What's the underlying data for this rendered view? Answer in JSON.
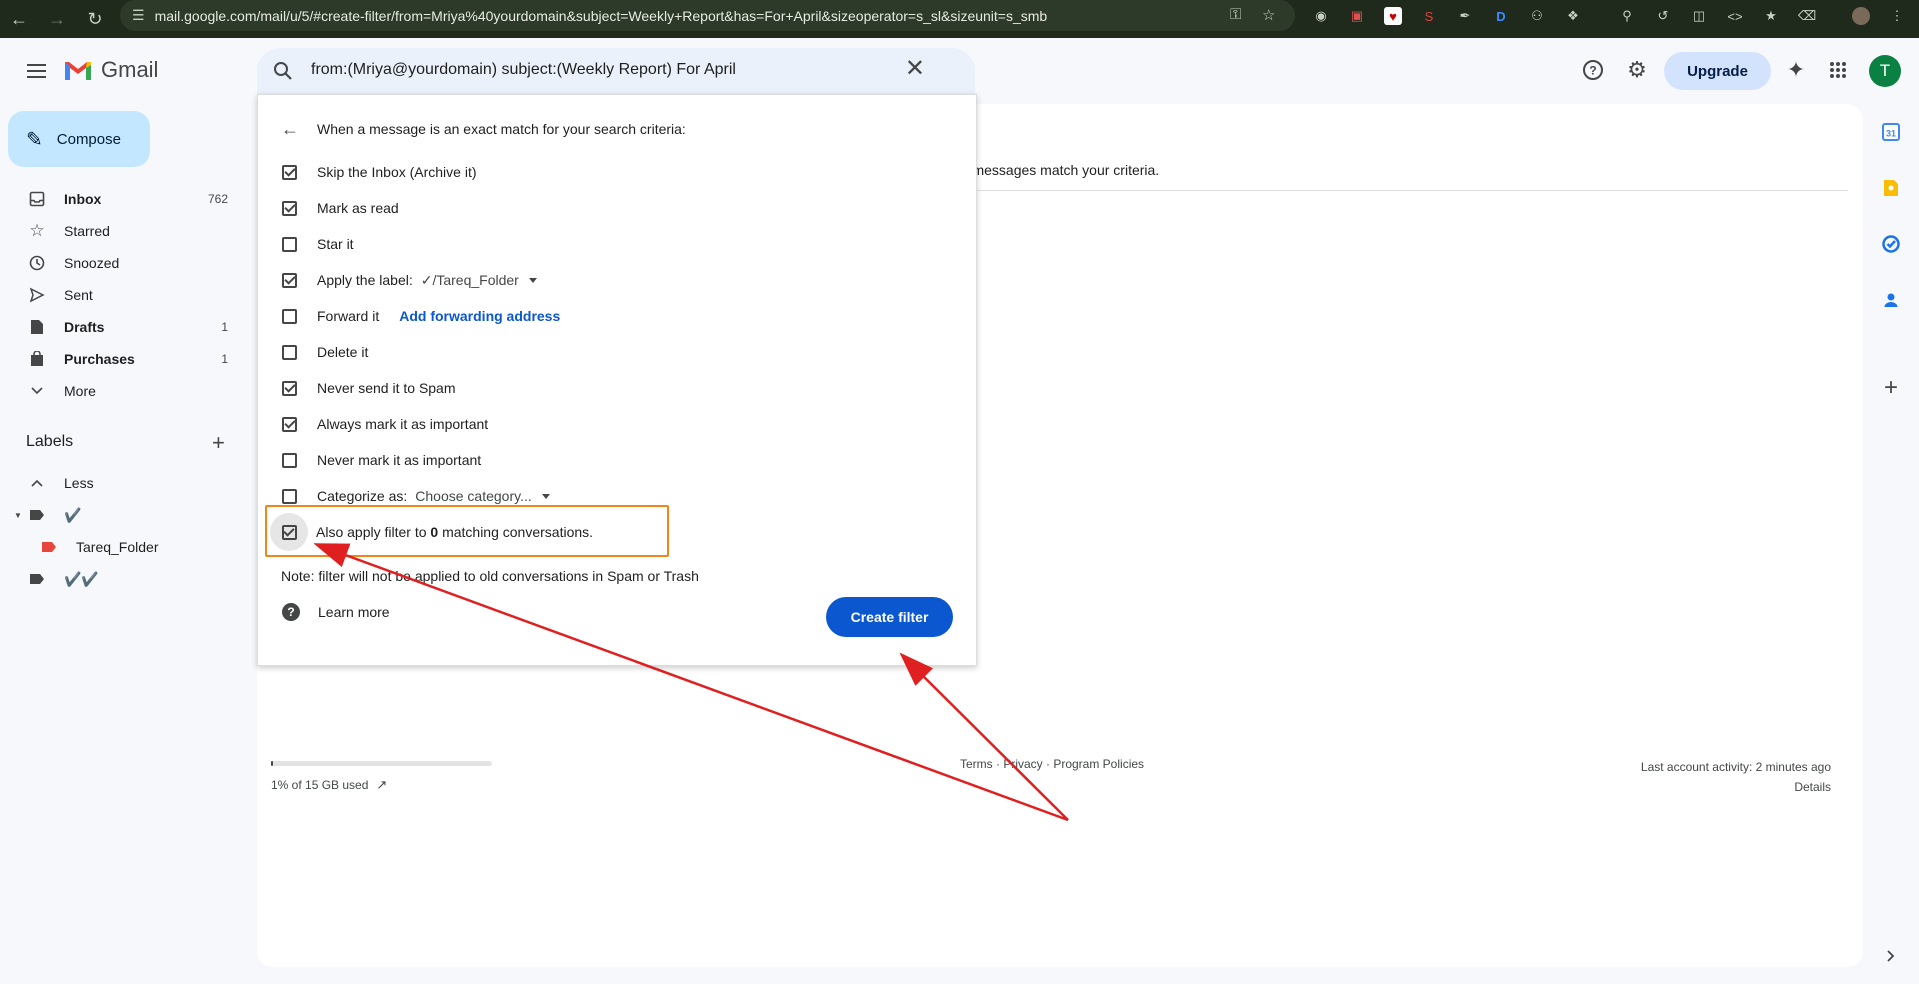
{
  "browser": {
    "url": "mail.google.com/mail/u/5/#create-filter/from=Mriya%40yourdomain&subject=Weekly+Report&has=For+April&sizeoperator=s_sl&sizeunit=s_smb"
  },
  "app": {
    "logo_text": "Gmail",
    "search_query": "from:(Mriya@yourdomain) subject:(Weekly Report) For April",
    "upgrade_label": "Upgrade",
    "avatar_letter": "T"
  },
  "sidebar": {
    "compose_label": "Compose",
    "items": [
      {
        "label": "Inbox",
        "count": "762",
        "icon": "inbox-icon"
      },
      {
        "label": "Starred",
        "count": "",
        "icon": "star-icon"
      },
      {
        "label": "Snoozed",
        "count": "",
        "icon": "clock-icon"
      },
      {
        "label": "Sent",
        "count": "",
        "icon": "send-icon"
      },
      {
        "label": "Drafts",
        "count": "1",
        "icon": "draft-icon"
      },
      {
        "label": "Purchases",
        "count": "1",
        "icon": "shopping-bag-icon"
      },
      {
        "label": "More",
        "count": "",
        "icon": "chevron-down-icon"
      }
    ],
    "labels_title": "Labels",
    "less_label": "Less",
    "labels": [
      {
        "label": "✔️"
      },
      {
        "label": "Tareq_Folder"
      },
      {
        "label": "✔️✔️"
      }
    ]
  },
  "filter_dialog": {
    "header": "When a message is an exact match for your search criteria:",
    "options": [
      {
        "label": "Skip the Inbox (Archive it)",
        "checked": true
      },
      {
        "label": "Mark as read",
        "checked": true
      },
      {
        "label": "Star it",
        "checked": false
      },
      {
        "label": "Apply the label:",
        "checked": true,
        "select": "✓/Tareq_Folder"
      },
      {
        "label": "Forward it",
        "checked": false,
        "link": "Add forwarding address"
      },
      {
        "label": "Delete it",
        "checked": false
      },
      {
        "label": "Never send it to Spam",
        "checked": true
      },
      {
        "label": "Always mark it as important",
        "checked": true
      },
      {
        "label": "Never mark it as important",
        "checked": false
      },
      {
        "label": "Categorize as:",
        "checked": false,
        "select": "Choose category..."
      }
    ],
    "apply_filter": {
      "prefix": "Also apply filter to ",
      "count": "0",
      "suffix": " matching conversations.",
      "checked": true
    },
    "note": "Note: filter will not be applied to old conversations in Spam or Trash",
    "learn_more": "Learn more",
    "create_button": "Create filter"
  },
  "background": {
    "partial_text": "ng messages match your criteria."
  },
  "footer": {
    "storage": "1% of 15 GB used",
    "storage_percent": 1,
    "links": "Terms · Privacy · Program Policies",
    "activity": "Last account activity: 2 minutes ago",
    "details": "Details"
  },
  "colors": {
    "accent": "#0b57d0",
    "compose_bg": "#c2e7ff",
    "highlight": "#f0861a",
    "arrow": "#e02020"
  }
}
